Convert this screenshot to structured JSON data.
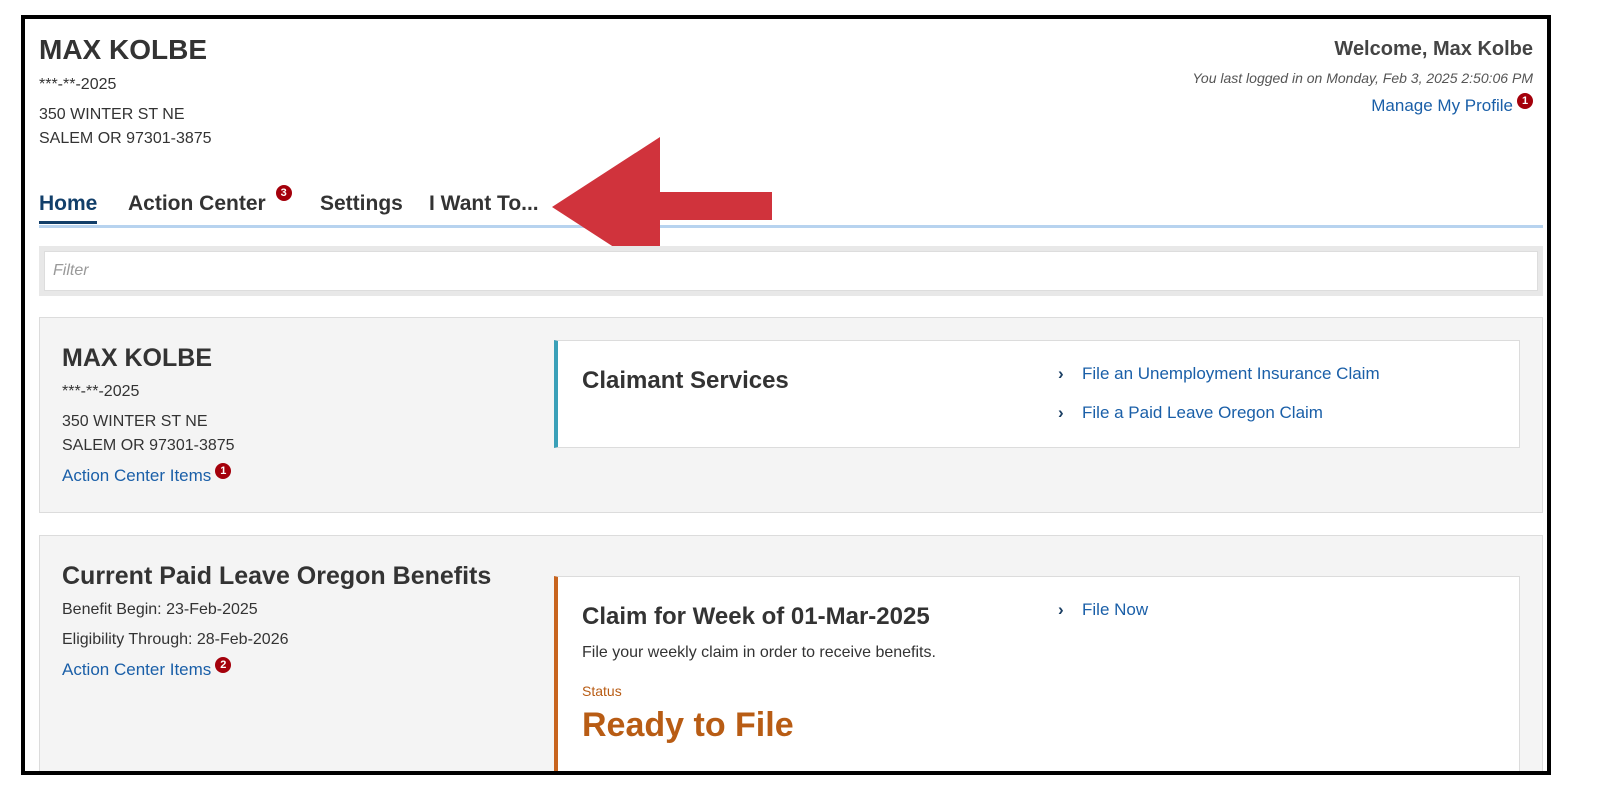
{
  "header": {
    "name": "MAX KOLBE",
    "ssn": "***-**-2025",
    "address_line1": "350 WINTER ST NE",
    "address_line2": "SALEM OR 97301-3875",
    "welcome": "Welcome, Max Kolbe",
    "last_login": "You last logged in on Monday, Feb 3, 2025 2:50:06 PM",
    "manage_profile": "Manage My Profile",
    "manage_profile_badge": "1"
  },
  "tabs": [
    {
      "label": "Home",
      "active": true
    },
    {
      "label": "Action Center",
      "badge": "3"
    },
    {
      "label": "Settings"
    },
    {
      "label": "I Want To..."
    }
  ],
  "filter": {
    "placeholder": "Filter"
  },
  "panel1": {
    "name": "MAX KOLBE",
    "ssn": "***-**-2025",
    "address_line1": "350 WINTER ST NE",
    "address_line2": "SALEM OR 97301-3875",
    "link": "Action Center Items",
    "link_badge": "1",
    "card": {
      "title": "Claimant Services",
      "links": [
        "File an Unemployment Insurance Claim",
        "File a Paid Leave Oregon Claim"
      ]
    }
  },
  "panel2": {
    "title": "Current Paid Leave Oregon Benefits",
    "benefit_begin": "Benefit Begin: 23-Feb-2025",
    "eligibility": "Eligibility Through: 28-Feb-2026",
    "link": "Action Center Items",
    "link_badge": "2",
    "card": {
      "title": "Claim for Week of 01-Mar-2025",
      "description": "File your weekly claim in order to receive benefits.",
      "status_label": "Status",
      "status_value": "Ready to File",
      "links": [
        "File Now"
      ]
    }
  },
  "colors": {
    "link": "#1a5fa8",
    "badge": "#a4000b",
    "arrow": "#d0333c",
    "status": "#b85c14",
    "tab_active": "#123f6a",
    "accent_teal": "#3aa0b8",
    "accent_orange": "#c8641e"
  }
}
